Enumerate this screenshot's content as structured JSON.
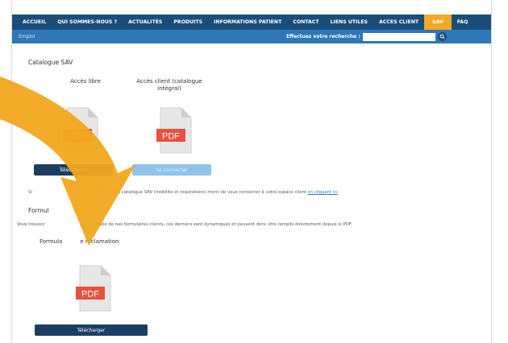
{
  "nav": {
    "items": [
      {
        "label": "ACCUEIL"
      },
      {
        "label": "QUI SOMMES-NOUS ?"
      },
      {
        "label": "ACTUALITÉS"
      },
      {
        "label": "PRODUITS"
      },
      {
        "label": "INFORMATIONS PATIENT"
      },
      {
        "label": "CONTACT"
      },
      {
        "label": "LIENS UTILES"
      },
      {
        "label": "ACCES CLIENT"
      },
      {
        "label": "SAV"
      },
      {
        "label": "FAQ"
      }
    ],
    "active_label": "SAV"
  },
  "subbar": {
    "breadcrumb": "Emploi",
    "search_label": "Effectuez votre recherche :",
    "search_value": ""
  },
  "catalogue": {
    "title": "Catalogue SAV",
    "free_heading": "Accès libre",
    "client_heading": "Accès client (catalogue intégral)",
    "pdf_label": "PDF",
    "download_label": "Télécharger",
    "connect_label": "Se connecter",
    "note_start": "Si",
    "note_text": "intégralité du catalogue SAV (mobilité et respiratoire) merci de vous connecter à votre espace client",
    "note_link": "en cliquant ici"
  },
  "forms": {
    "title": "Formul",
    "intro_start": "Vous trouvez",
    "intro_text": "e l'ensemble de nos formulaires clients, ces derniers sont dynamiques et peuvent donc être remplis directement depuis le PDF.",
    "form_heading_start": "Formula",
    "form_heading_end": "e réclamation",
    "pdf_label": "PDF",
    "download_label": "Télécharger"
  },
  "colors": {
    "nav_bg": "#1b4d7a",
    "nav_active": "#f3a82a",
    "subbar_bg": "#2e78b7",
    "button_dark": "#1c3d62",
    "button_light": "#8fc2ea",
    "pdf_red": "#e9503e",
    "arrow": "#f2a81f"
  },
  "icons": {
    "search": "search-icon",
    "pdf": "pdf-file-icon",
    "arrow": "annotation-arrow-icon"
  }
}
